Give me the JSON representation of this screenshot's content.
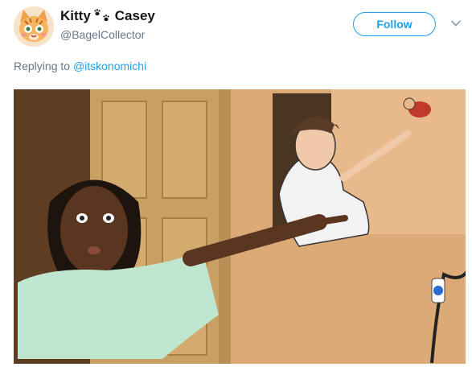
{
  "tweet": {
    "display_name_first": "Kitty",
    "display_name_second": "Casey",
    "handle": "@BagelCollector",
    "follow_label": "Follow",
    "replying_prefix": "Replying to",
    "replying_to": "@itskonomichi"
  },
  "icons": {
    "avatar": "cat-avatar-icon",
    "name_separator": "paw-prints-icon",
    "menu": "chevron-down-icon"
  },
  "colors": {
    "accent": "#1da1f2",
    "secondary_text": "#657786",
    "primary_text": "#14171a"
  }
}
